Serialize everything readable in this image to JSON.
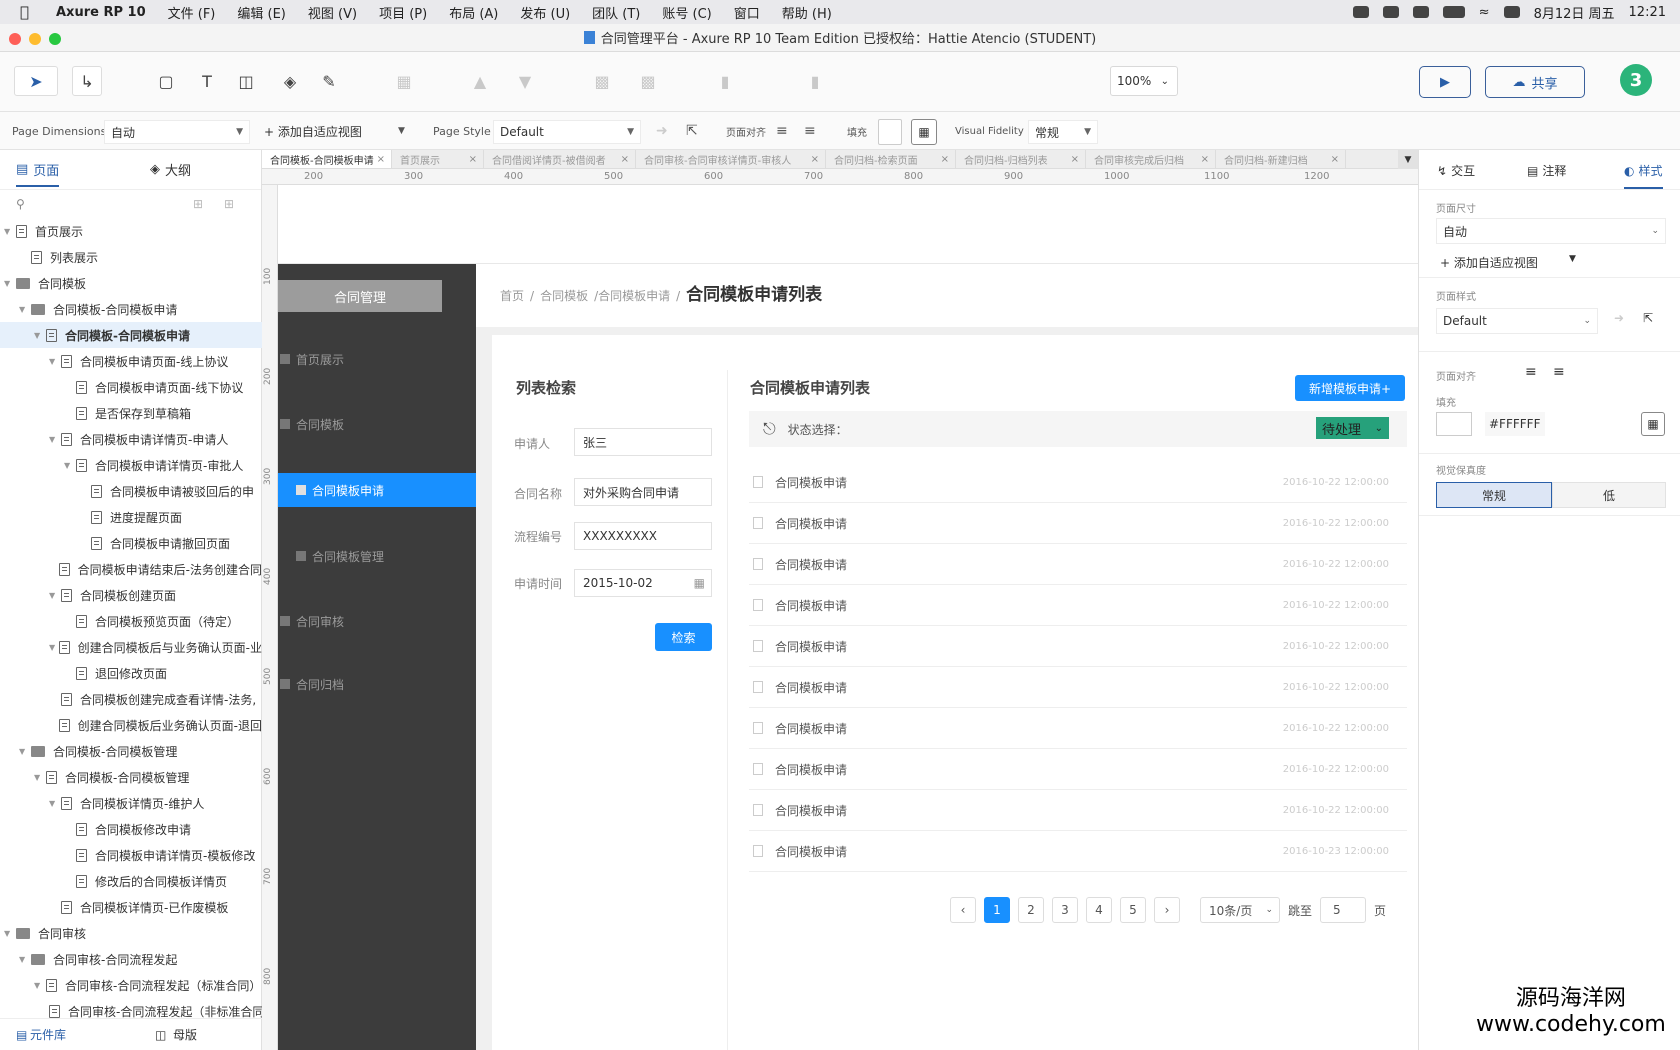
{
  "menubar": {
    "app_name": "Axure RP 10",
    "menus": [
      "文件 (F)",
      "编辑 (E)",
      "视图 (V)",
      "项目 (P)",
      "布局 (A)",
      "发布 (U)",
      "团队 (T)",
      "账号 (C)",
      "窗口",
      "帮助 (H)"
    ],
    "date": "8月12日 周五",
    "time": "12:21"
  },
  "titlebar": {
    "title": "合同管理平台 - Axure RP 10 Team Edition  已授权给：Hattie Atencio (STUDENT)"
  },
  "toolbar": {
    "zoom": "100%",
    "share_label": "共享",
    "avatar": "3"
  },
  "propbar": {
    "page_dimensions_label": "Page Dimensions",
    "page_dimensions_value": "自动",
    "add_view": "+ 添加自适应视图",
    "page_style_label": "Page Style",
    "page_style_value": "Default",
    "align_label": "页面对齐",
    "fill_label": "填充",
    "fidelity_label": "Visual Fidelity",
    "fidelity_value": "常规"
  },
  "leftpanel": {
    "tab_pages": "页面",
    "tab_outline": "大纲",
    "tree": [
      {
        "label": "首页展示",
        "type": "page",
        "indent": 0,
        "twisty": true
      },
      {
        "label": "列表展示",
        "type": "page",
        "indent": 1,
        "twisty": false
      },
      {
        "label": "合同模板",
        "type": "folder",
        "indent": 0,
        "twisty": true
      },
      {
        "label": "合同模板-合同模板申请",
        "type": "folder",
        "indent": 1,
        "twisty": true
      },
      {
        "label": "合同模板-合同模板申请",
        "type": "page",
        "indent": 2,
        "twisty": true,
        "active": true
      },
      {
        "label": "合同模板申请页面-线上协议",
        "type": "page",
        "indent": 3,
        "twisty": true
      },
      {
        "label": "合同模板申请页面-线下协议",
        "type": "page",
        "indent": 4,
        "twisty": false
      },
      {
        "label": "是否保存到草稿箱",
        "type": "page",
        "indent": 4,
        "twisty": false
      },
      {
        "label": "合同模板申请详情页-申请人",
        "type": "page",
        "indent": 3,
        "twisty": true
      },
      {
        "label": "合同模板申请详情页-审批人",
        "type": "page",
        "indent": 4,
        "twisty": true
      },
      {
        "label": "合同模板申请被驳回后的申",
        "type": "page",
        "indent": 5,
        "twisty": false
      },
      {
        "label": "进度提醒页面",
        "type": "page",
        "indent": 5,
        "twisty": false
      },
      {
        "label": "合同模板申请撤回页面",
        "type": "page",
        "indent": 5,
        "twisty": false
      },
      {
        "label": "合同模板申请结束后-法务创建合同",
        "type": "page",
        "indent": 3,
        "twisty": false
      },
      {
        "label": "合同模板创建页面",
        "type": "page",
        "indent": 3,
        "twisty": true
      },
      {
        "label": "合同模板预览页面（待定）",
        "type": "page",
        "indent": 4,
        "twisty": false
      },
      {
        "label": "创建合同模板后与业务确认页面-业",
        "type": "page",
        "indent": 3,
        "twisty": true
      },
      {
        "label": "退回修改页面",
        "type": "page",
        "indent": 4,
        "twisty": false
      },
      {
        "label": "合同模板创建完成查看详情-法务,",
        "type": "page",
        "indent": 3,
        "twisty": false
      },
      {
        "label": "创建合同模板后业务确认页面-退回",
        "type": "page",
        "indent": 3,
        "twisty": false
      },
      {
        "label": "合同模板-合同模板管理",
        "type": "folder",
        "indent": 1,
        "twisty": true
      },
      {
        "label": "合同模板-合同模板管理",
        "type": "page",
        "indent": 2,
        "twisty": true
      },
      {
        "label": "合同模板详情页-维护人",
        "type": "page",
        "indent": 3,
        "twisty": true
      },
      {
        "label": "合同模板修改申请",
        "type": "page",
        "indent": 4,
        "twisty": false
      },
      {
        "label": "合同模板申请详情页-模板修改",
        "type": "page",
        "indent": 4,
        "twisty": false
      },
      {
        "label": "修改后的合同模板详情页",
        "type": "page",
        "indent": 4,
        "twisty": false
      },
      {
        "label": "合同模板详情页-已作废模板",
        "type": "page",
        "indent": 3,
        "twisty": false
      },
      {
        "label": "合同审核",
        "type": "folder",
        "indent": 0,
        "twisty": true
      },
      {
        "label": "合同审核-合同流程发起",
        "type": "folder",
        "indent": 1,
        "twisty": true
      },
      {
        "label": "合同审核-合同流程发起（标准合同）",
        "type": "page",
        "indent": 2,
        "twisty": true
      },
      {
        "label": "合同审核-合同流程发起（非标准合同）",
        "type": "page",
        "indent": 3,
        "twisty": false
      }
    ],
    "footer_library": "元件库",
    "footer_masters": "母版"
  },
  "doc_tabs": [
    {
      "label": "合同模板-合同模板申请",
      "active": true
    },
    {
      "label": "首页展示"
    },
    {
      "label": "合同借阅详情页-被借阅者"
    },
    {
      "label": "合同审核-合同审核详情页-审核人"
    },
    {
      "label": "合同归档-检索页面"
    },
    {
      "label": "合同归档-归档列表"
    },
    {
      "label": "合同审核完成后归档"
    },
    {
      "label": "合同归档-新建归档"
    }
  ],
  "ruler": {
    "h_labels": [
      "200",
      "300",
      "400",
      "500",
      "600",
      "700",
      "800",
      "900",
      "1000",
      "1100",
      "1200"
    ],
    "v_labels": [
      "100",
      "200",
      "300",
      "400",
      "500",
      "600",
      "700",
      "800"
    ]
  },
  "canvas": {
    "brand": "合同管理",
    "nav": [
      "首页展示",
      "合同模板",
      "合同模板申请",
      "合同模板管理",
      "合同审核",
      "合同归档"
    ],
    "nav_active_index": 2,
    "breadcrumb": [
      "首页",
      "/",
      "合同模板",
      "/合同模板申请",
      "/"
    ],
    "breadcrumb_current": "合同模板申请列表",
    "search": {
      "title": "列表检索",
      "applicant_label": "申请人",
      "applicant_value": "张三",
      "contract_name_label": "合同名称",
      "contract_name_value": "对外采购合同申请",
      "flow_no_label": "流程编号",
      "flow_no_value": "XXXXXXXXX",
      "date_label": "申请时间",
      "date_value": "2015-10-02",
      "button": "检索"
    },
    "list": {
      "title": "合同模板申请列表",
      "add_button": "新增模板申请+",
      "status_label": "状态选择：",
      "status_value": "待处理",
      "rows": [
        {
          "title": "合同模板申请",
          "date": "2016-10-22 12:00:00"
        },
        {
          "title": "合同模板申请",
          "date": "2016-10-22 12:00:00"
        },
        {
          "title": "合同模板申请",
          "date": "2016-10-22 12:00:00"
        },
        {
          "title": "合同模板申请",
          "date": "2016-10-22 12:00:00"
        },
        {
          "title": "合同模板申请",
          "date": "2016-10-22 12:00:00"
        },
        {
          "title": "合同模板申请",
          "date": "2016-10-22 12:00:00"
        },
        {
          "title": "合同模板申请",
          "date": "2016-10-22 12:00:00"
        },
        {
          "title": "合同模板申请",
          "date": "2016-10-22 12:00:00"
        },
        {
          "title": "合同模板申请",
          "date": "2016-10-22 12:00:00"
        },
        {
          "title": "合同模板申请",
          "date": "2016-10-23 12:00:00"
        }
      ]
    },
    "pager": {
      "pages": [
        "1",
        "2",
        "3",
        "4",
        "5"
      ],
      "active": "1",
      "per_page": "10条/页",
      "jump_label": "跳至",
      "jump_value": "5",
      "page_suffix": "页"
    }
  },
  "rightpanel": {
    "tab_interact": "交互",
    "tab_notes": "注释",
    "tab_style": "样式",
    "page_size_label": "页面尺寸",
    "page_size_value": "自动",
    "add_view": "+ 添加自适应视图",
    "page_style_label": "页面样式",
    "page_style_value": "Default",
    "align_label": "页面对齐",
    "fill_label": "填充",
    "fill_value": "#FFFFFF",
    "fidelity_label": "视觉保真度",
    "fidelity_normal": "常规",
    "fidelity_low": "低"
  },
  "watermark": {
    "line1": "源码海洋网",
    "line2": "www.codehy.com"
  },
  "colors": {
    "accent": "#1890ff",
    "sidenav": "#3c3c3c",
    "status": "#26a17b",
    "avatar": "#2bb47a"
  }
}
